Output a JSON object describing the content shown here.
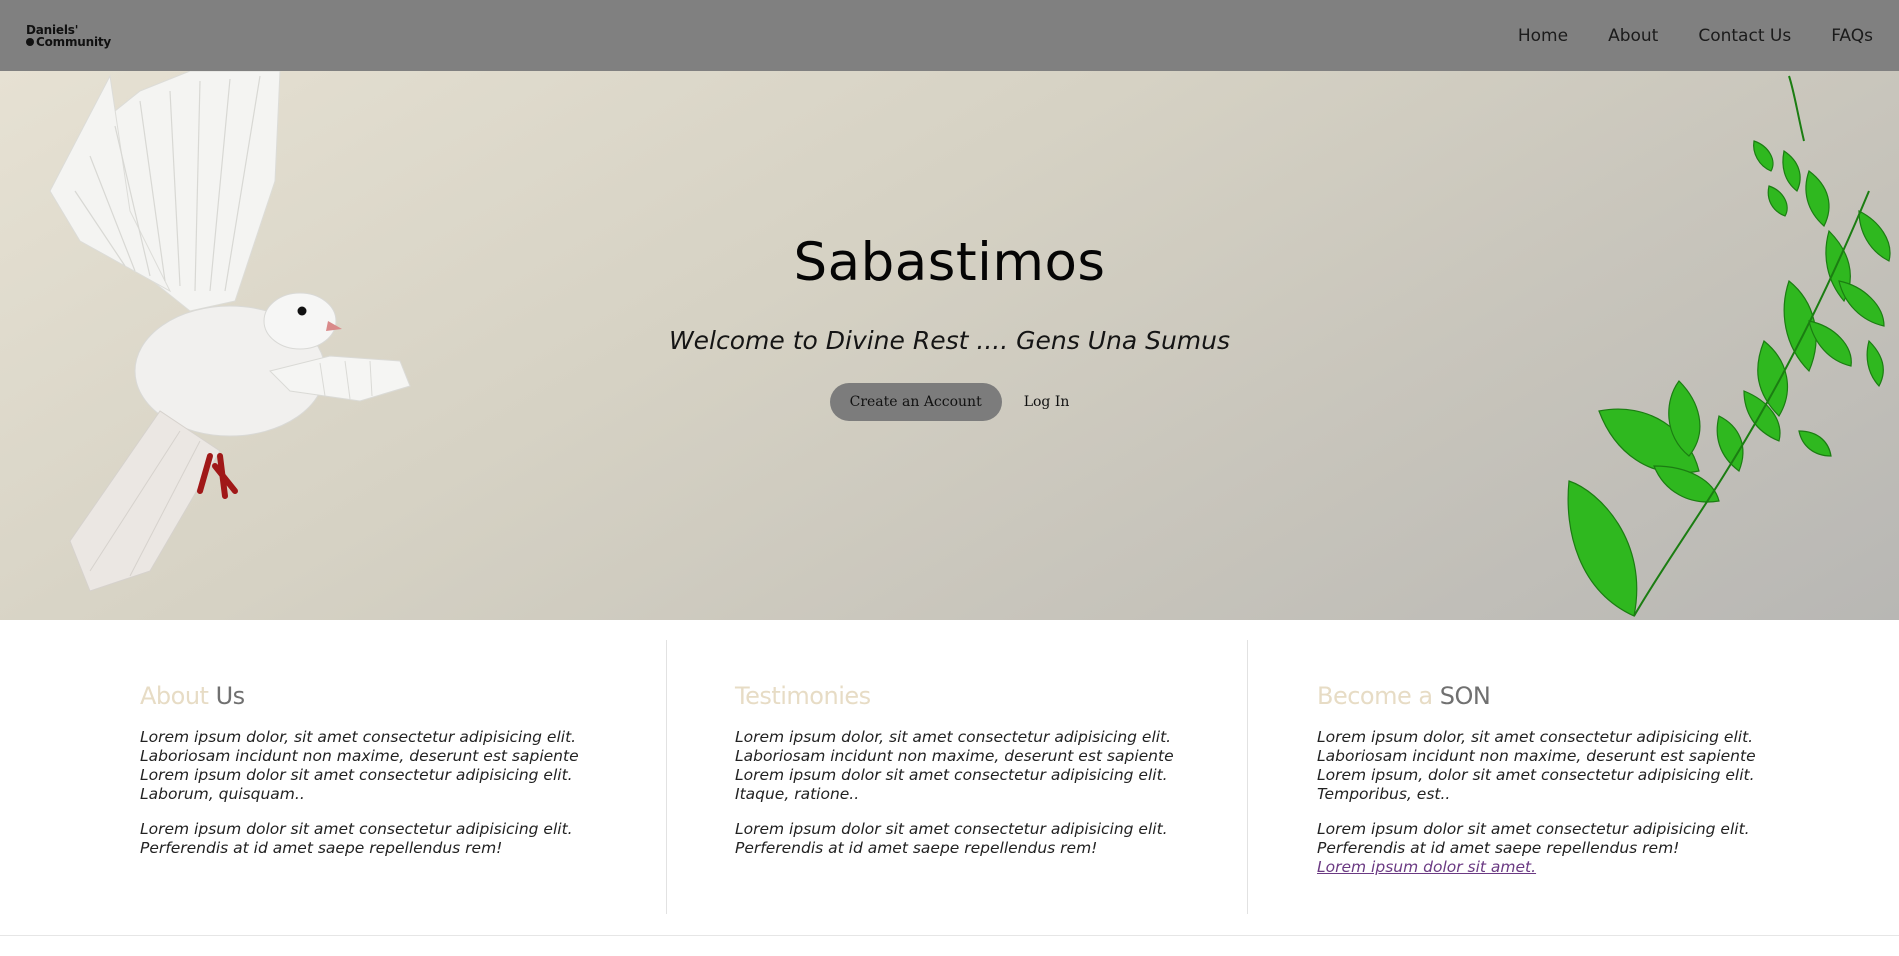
{
  "header": {
    "logo": {
      "line1": "Daniels'",
      "line2": "Community"
    },
    "nav": [
      {
        "label": "Home"
      },
      {
        "label": "About"
      },
      {
        "label": "Contact Us"
      },
      {
        "label": "FAQs"
      }
    ]
  },
  "hero": {
    "title": "Sabastimos",
    "subtitle": "Welcome to Divine Rest .... Gens Una Sumus",
    "primary_button": "Create an Account",
    "secondary_button": "Log In"
  },
  "sections": {
    "about": {
      "heading_accent": "About",
      "heading_main": "Us",
      "p1": " Lorem ipsum dolor, sit amet consectetur adipisicing elit. Laboriosam incidunt non maxime, deserunt est sapiente Lorem ipsum dolor sit amet consectetur adipisicing elit. Laborum, quisquam..",
      "p2": " Lorem ipsum dolor sit amet consectetur adipisicing elit. Perferendis at id amet saepe repellendus rem!"
    },
    "testimonies": {
      "heading_accent": "Testimonies",
      "heading_main": "",
      "p1": " Lorem ipsum dolor, sit amet consectetur adipisicing elit. Laboriosam incidunt non maxime, deserunt est sapiente Lorem ipsum dolor sit amet consectetur adipisicing elit. Itaque, ratione..",
      "p2": " Lorem ipsum dolor sit amet consectetur adipisicing elit. Perferendis at id amet saepe repellendus rem!"
    },
    "become_son": {
      "heading_accent": "Become a",
      "heading_main": "SON",
      "p1": " Lorem ipsum dolor, sit amet consectetur adipisicing elit. Laboriosam incidunt non maxime, deserunt est sapiente Lorem ipsum, dolor sit amet consectetur adipisicing elit. Temporibus, est..",
      "p2": " Lorem ipsum dolor sit amet consectetur adipisicing elit. Perferendis at id amet saepe repellendus rem!",
      "link": "Lorem ipsum dolor sit amet."
    }
  },
  "colors": {
    "header_bg": "#808080",
    "heading_accent": "#e7dcc5",
    "heading_main": "#707070",
    "primary_button_bg": "#7c7c7c",
    "link": "#6b3a83"
  },
  "icons": {
    "logo_dot": "dot-icon",
    "hero_left_image": "dove-illustration",
    "hero_right_image": "green-leaves-illustration"
  }
}
